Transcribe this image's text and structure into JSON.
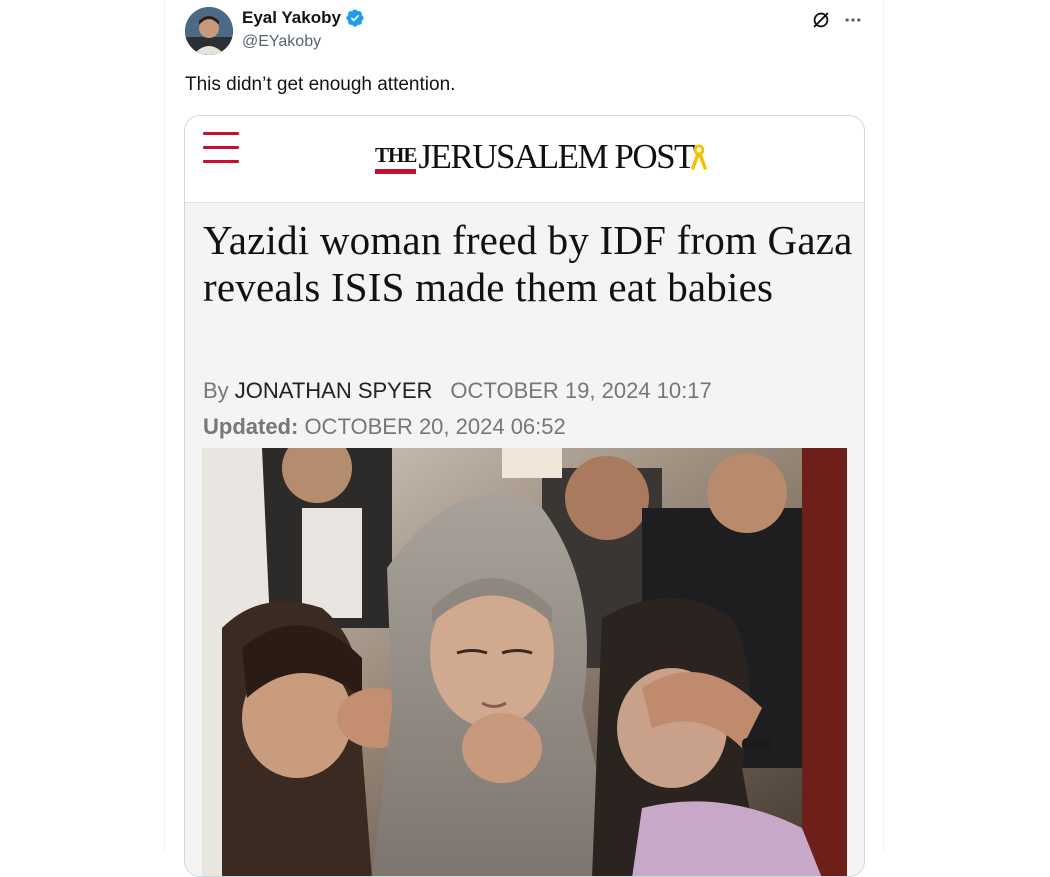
{
  "tweet": {
    "display_name": "Eyal Yakoby",
    "handle": "@EYakoby",
    "text": "This didn’t get enough attention.",
    "icons": {
      "verified": "verified-badge-icon",
      "grok": "grok-icon",
      "more": "more-icon"
    },
    "colors": {
      "verified": "#1d9bf0",
      "text": "#0f1419",
      "secondary": "#536471"
    }
  },
  "article": {
    "publication": {
      "the": "THE",
      "name": "JERUSALEM POST"
    },
    "headline": "Yazidi woman freed by IDF from Gaza reveals ISIS made them eat babies",
    "byline_prefix": "By ",
    "author": "JONATHAN SPYER",
    "published": "OCTOBER 19, 2024 10:17",
    "updated_label": "Updated:",
    "updated": " OCTOBER 20, 2024 06:52",
    "colors": {
      "brand_red": "#c8102e"
    }
  }
}
